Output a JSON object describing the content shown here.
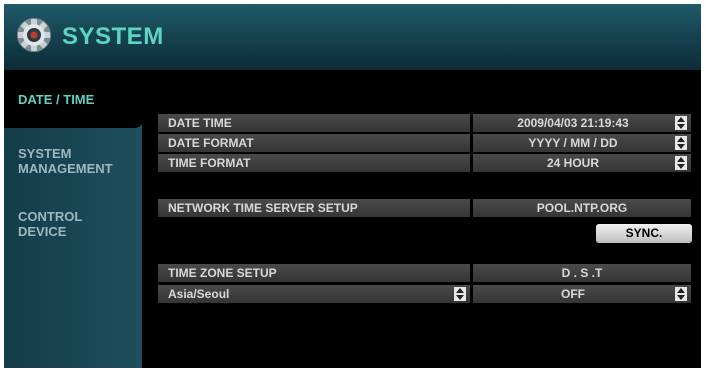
{
  "window": {
    "title": "SYSTEM"
  },
  "sidebar": {
    "tabs": [
      {
        "line1": "DATE / TIME",
        "line2": ""
      },
      {
        "line1": "SYSTEM",
        "line2": "MANAGEMENT"
      },
      {
        "line1": "CONTROL",
        "line2": "DEVICE"
      }
    ]
  },
  "date_time": {
    "label": "DATE TIME",
    "value": "2009/04/03   21:19:43"
  },
  "date_format": {
    "label": "DATE FORMAT",
    "value": "YYYY / MM / DD"
  },
  "time_format": {
    "label": "TIME FORMAT",
    "value": "24 HOUR"
  },
  "ntp": {
    "label": "NETWORK TIME SERVER SETUP",
    "value": "POOL.NTP.ORG",
    "sync_label": "SYNC."
  },
  "time_zone": {
    "label": "TIME ZONE SETUP",
    "value": "Asia/Seoul"
  },
  "dst": {
    "label": "D . S .T",
    "value": "OFF"
  },
  "colors": {
    "accent": "#5fd3c2",
    "title_bar": "#164452",
    "row_bg": "#3d3d3d"
  }
}
